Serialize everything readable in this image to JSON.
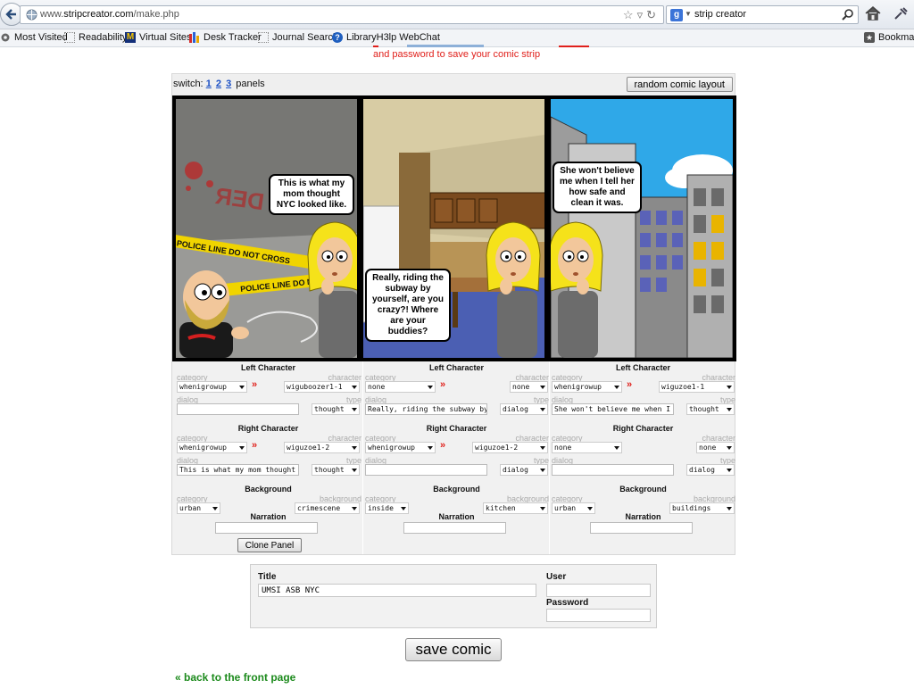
{
  "browser": {
    "url_host": "www.",
    "url_domain": "stripcreator.com",
    "url_path": "/make.php",
    "search_text": "strip creator",
    "search_engine_glyph": "g",
    "bookmarks": [
      "Most Visited",
      "Readability",
      "Virtual Sites",
      "Desk Tracker",
      "Journal Search",
      "LibraryH3lp WebChat"
    ],
    "bookmarks_menu": "Bookma"
  },
  "page": {
    "login_note": "and password to save your comic strip",
    "switch_label": "switch:",
    "switch_options": [
      "1",
      "2",
      "3"
    ],
    "switch_suffix": "panels",
    "random_layout_button": "random comic layout",
    "back_link": "« back to the front page"
  },
  "strip": {
    "panels": [
      {
        "background": "crimescene",
        "bubble_right": "This is what my mom thought NYC looked like.",
        "tape_text": "POLICE LINE DO NOT CROSS"
      },
      {
        "background": "kitchen",
        "bubble_left": "Really, riding the subway by yourself, are you crazy?! Where are your buddies?"
      },
      {
        "background": "buildings",
        "bubble_left": "She won't believe me when I tell her how safe and clean it was."
      }
    ]
  },
  "labels": {
    "left_character": "Left Character",
    "right_character": "Right Character",
    "background": "Background",
    "narration": "Narration",
    "category": "category",
    "character": "character",
    "dialog": "dialog",
    "type": "type",
    "background_lbl": "background",
    "raquo": "»",
    "clone_button": "Clone Panel"
  },
  "controls": [
    {
      "left": {
        "category": "whenigrowup",
        "character": "wiguboozer1-1",
        "dialog": "",
        "type": "thought"
      },
      "right": {
        "category": "whenigrowup",
        "character": "wiguzoe1-2",
        "dialog": "This is what my mom thought NY",
        "type": "thought"
      },
      "bg": {
        "category": "urban",
        "background": "crimescene"
      },
      "narration": ""
    },
    {
      "left": {
        "category": "none",
        "character": "none",
        "dialog": "Really, riding the subway by your",
        "type": "dialog"
      },
      "right": {
        "category": "whenigrowup",
        "character": "wiguzoe1-2",
        "dialog": "",
        "type": "dialog"
      },
      "bg": {
        "category": "inside",
        "background": "kitchen"
      },
      "narration": ""
    },
    {
      "left": {
        "category": "whenigrowup",
        "character": "wiguzoe1-1",
        "dialog": "She won't believe me when I tell",
        "type": "thought"
      },
      "right": {
        "category": "none",
        "character": "none",
        "dialog": "",
        "type": "dialog"
      },
      "bg": {
        "category": "urban",
        "background": "buildings"
      },
      "narration": ""
    }
  ],
  "save_form": {
    "title_label": "Title",
    "title_value": "UMSI ASB NYC",
    "user_label": "User",
    "user_value": "",
    "password_label": "Password",
    "password_value": "",
    "save_button": "save comic"
  },
  "colors": {
    "link_blue": "#1b4fc4",
    "alert_red": "#e0201b",
    "back_green": "#1c8a1c"
  }
}
